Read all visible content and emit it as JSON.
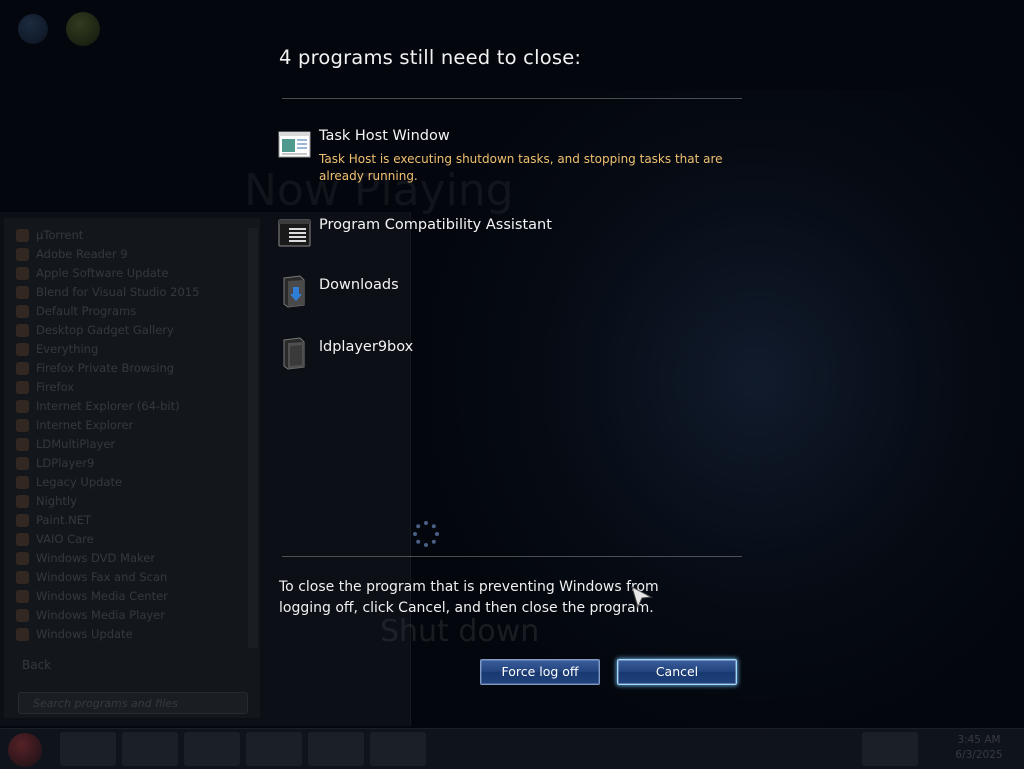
{
  "dialog": {
    "title": "4 programs still need to close:",
    "programs": [
      {
        "name": "Task Host Window",
        "description": "Task Host is executing shutdown tasks, and stopping tasks that are already running.",
        "icon": "task-host-icon"
      },
      {
        "name": "Program Compatibility Assistant",
        "description": "",
        "icon": "console-window-icon"
      },
      {
        "name": "Downloads",
        "description": "",
        "icon": "downloads-folder-icon"
      },
      {
        "name": "ldplayer9box",
        "description": "",
        "icon": "folder-icon"
      }
    ],
    "message": "To close the program that is preventing Windows from logging off, click Cancel, and then close the program.",
    "buttons": {
      "force_log_off": "Force log off",
      "cancel": "Cancel"
    }
  },
  "background": {
    "start_menu_items": [
      "µTorrent",
      "Adobe Reader 9",
      "Apple Software Update",
      "Blend for Visual Studio 2015",
      "Default Programs",
      "Desktop Gadget Gallery",
      "Everything",
      "Firefox Private Browsing",
      "Firefox",
      "Internet Explorer (64-bit)",
      "Internet Explorer",
      "LDMultiPlayer",
      "LDPlayer9",
      "Legacy Update",
      "Nightly",
      "Paint.NET",
      "VAIO Care",
      "Windows DVD Maker",
      "Windows Fax and Scan",
      "Windows Media Center",
      "Windows Media Player",
      "Windows Update"
    ],
    "start_menu_back": "Back",
    "start_menu_search_placeholder": "Search programs and files",
    "clock_time": "3:45 AM",
    "clock_date": "6/3/2025"
  },
  "colors": {
    "background": "#03060c",
    "description_text": "#f0c070",
    "button_fill": "#23447e",
    "focus_glow": "#9ad8ff"
  }
}
